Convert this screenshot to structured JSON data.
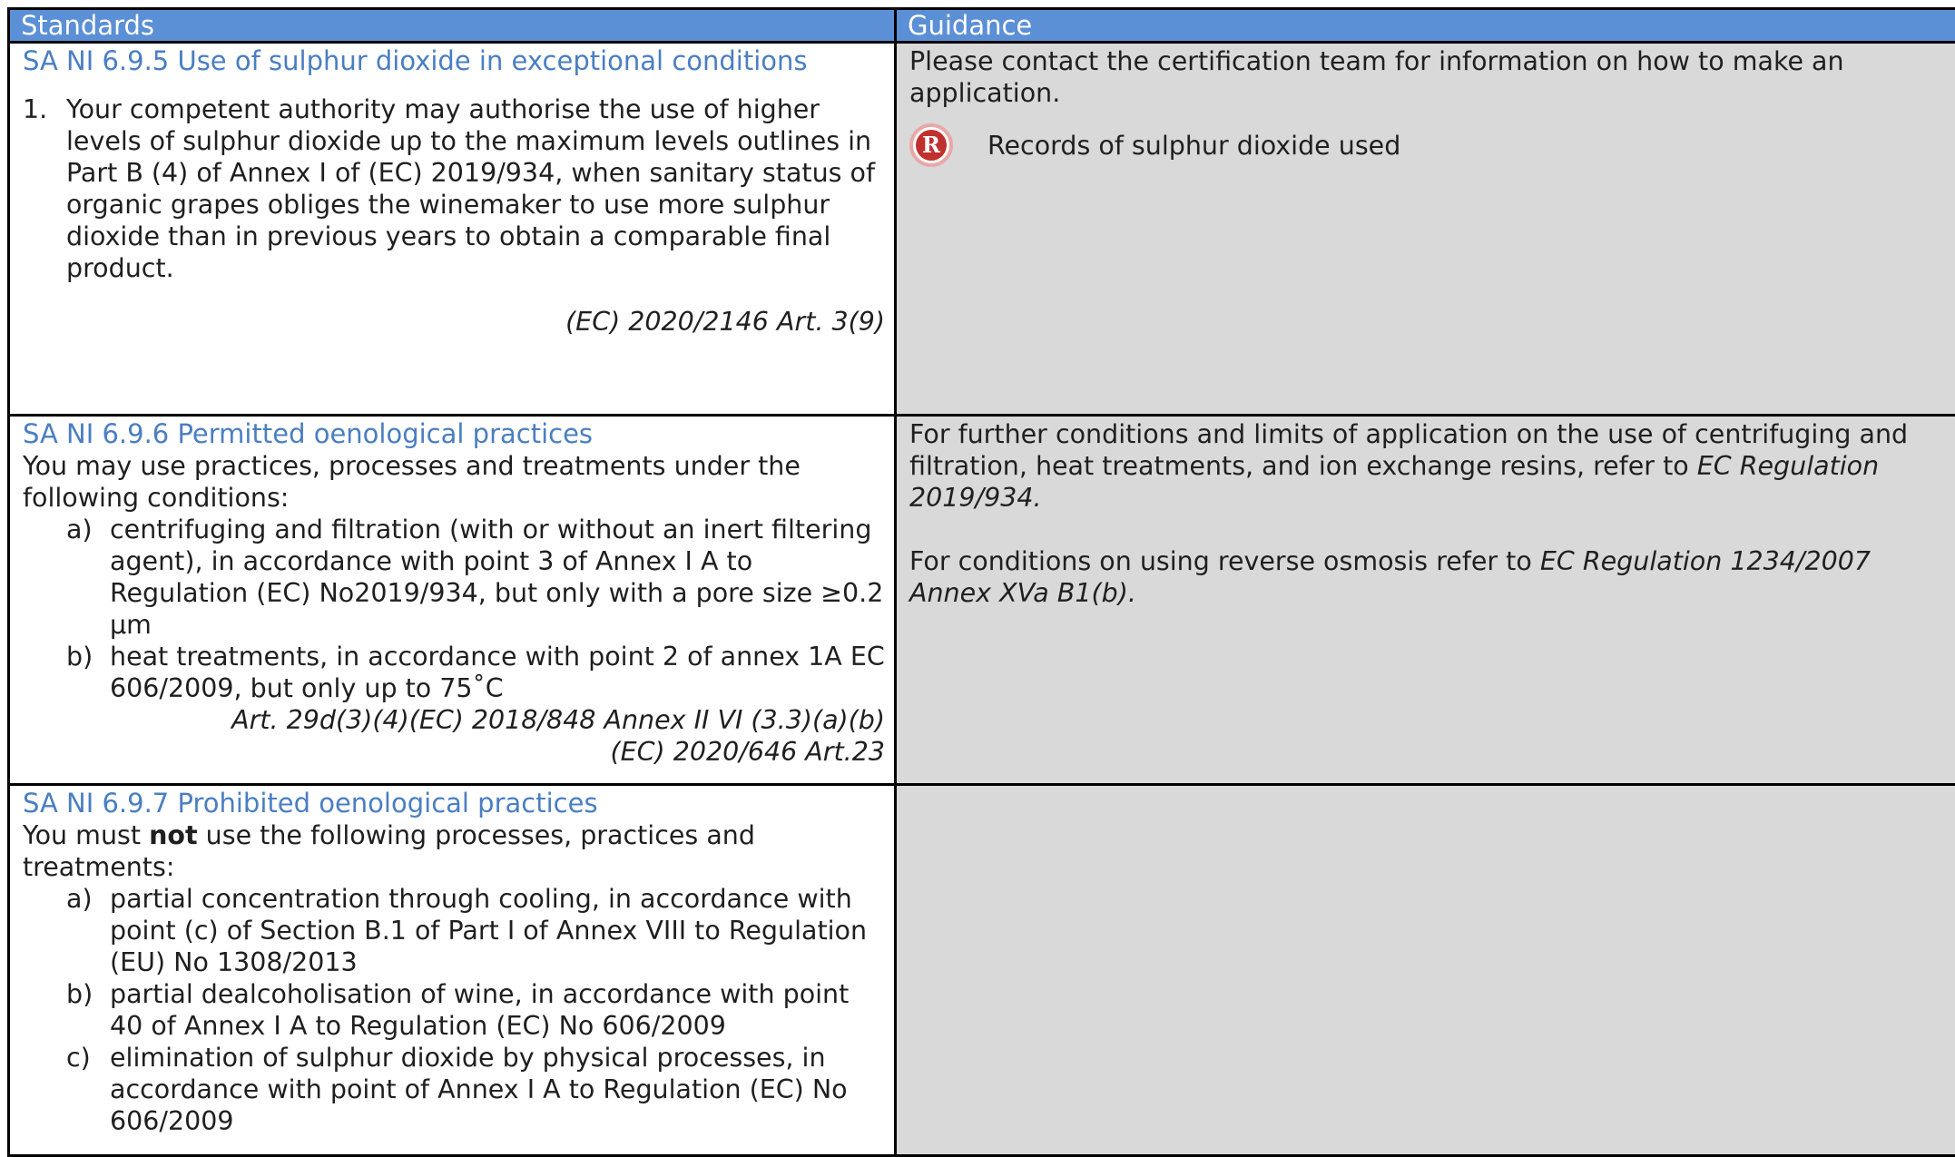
{
  "header": {
    "standards": "Standards",
    "guidance": "Guidance"
  },
  "rows": [
    {
      "title": "SA NI 6.9.5 Use of sulphur dioxide in exceptional conditions",
      "item_marker": "1.",
      "item_text": "Your competent authority may authorise the use of higher levels of sulphur dioxide up to the maximum levels outlines in Part B (4) of Annex I of (EC) 2019/934, when sanitary status of organic grapes obliges the winemaker to use more sulphur dioxide than in previous years to obtain a comparable final product.",
      "reference": "(EC) 2020/2146 Art. 3(9)",
      "guidance_text": "Please contact the certification team for information on how to make an application.",
      "record_icon": "R",
      "record_text": "Records of sulphur dioxide used"
    },
    {
      "title": "SA NI 6.9.6 Permitted oenological practices",
      "intro": "You may use practices, processes and treatments under the following conditions:",
      "items": [
        {
          "marker": "a)",
          "text": "centrifuging and filtration (with or without an inert filtering agent), in accordance with point 3 of Annex I A to Regulation (EC) No2019/934, but only with a pore size ≥0.2 μm"
        },
        {
          "marker": "b)",
          "text": "heat treatments, in accordance with point 2 of annex 1A EC 606/2009, but only up to 75˚C"
        }
      ],
      "reference_1": "Art. 29d(3)(4)(EC) 2018/848 Annex II VI (3.3)(a)(b)",
      "reference_2": "(EC) 2020/646 Art.23",
      "guidance_p1": "For further conditions and limits of application on the use of centrifuging and filtration, heat treatments, and ion exchange resins, refer to ",
      "guidance_p1_ref": "EC Regulation 2019/934.",
      "guidance_p2": "For conditions on using reverse osmosis refer to ",
      "guidance_p2_ref": "EC Regulation 1234/2007 Annex XVa B1(b)."
    },
    {
      "title": "SA NI 6.9.7 Prohibited oenological practices",
      "intro_pre": "You must ",
      "intro_bold": "not",
      "intro_post": " use the following processes, practices and treatments:",
      "items": [
        {
          "marker": "a)",
          "text": "partial concentration through cooling, in accordance with point (c) of Section B.1 of Part I of Annex VIII to Regulation (EU) No 1308/2013"
        },
        {
          "marker": "b)",
          "text": "partial dealcoholisation of wine, in accordance with point 40 of Annex I A to Regulation (EC) No 606/2009"
        },
        {
          "marker": "c)",
          "text": "elimination of sulphur dioxide by physical processes, in accordance with point  of Annex I A to Regulation (EC) No 606/2009"
        }
      ]
    }
  ]
}
